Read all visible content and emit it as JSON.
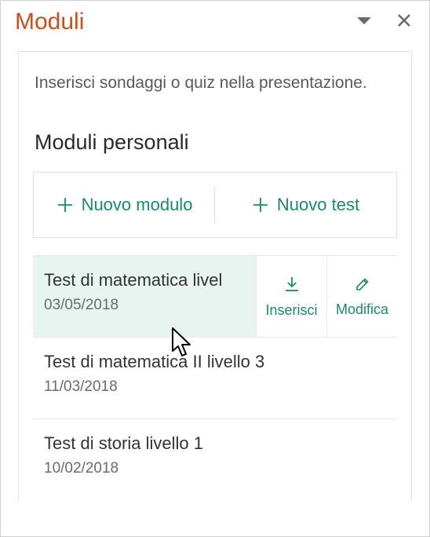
{
  "header": {
    "title": "Moduli"
  },
  "intro": "Inserisci sondaggi o quiz nella presentazione.",
  "section_title": "Moduli personali",
  "new_buttons": {
    "new_form": "Nuovo modulo",
    "new_quiz": "Nuovo test"
  },
  "actions": {
    "insert": "Inserisci",
    "edit": "Modifica"
  },
  "items": [
    {
      "title": "Test di matematica livel",
      "date": "03/05/2018"
    },
    {
      "title": "Test di matematica II livello 3",
      "date": "11/03/2018"
    },
    {
      "title": "Test di storia livello 1",
      "date": "10/02/2018"
    }
  ],
  "colors": {
    "accent_orange": "#d24b1b",
    "accent_green": "#1a8a6a",
    "selected_bg": "#e8f4f0"
  }
}
